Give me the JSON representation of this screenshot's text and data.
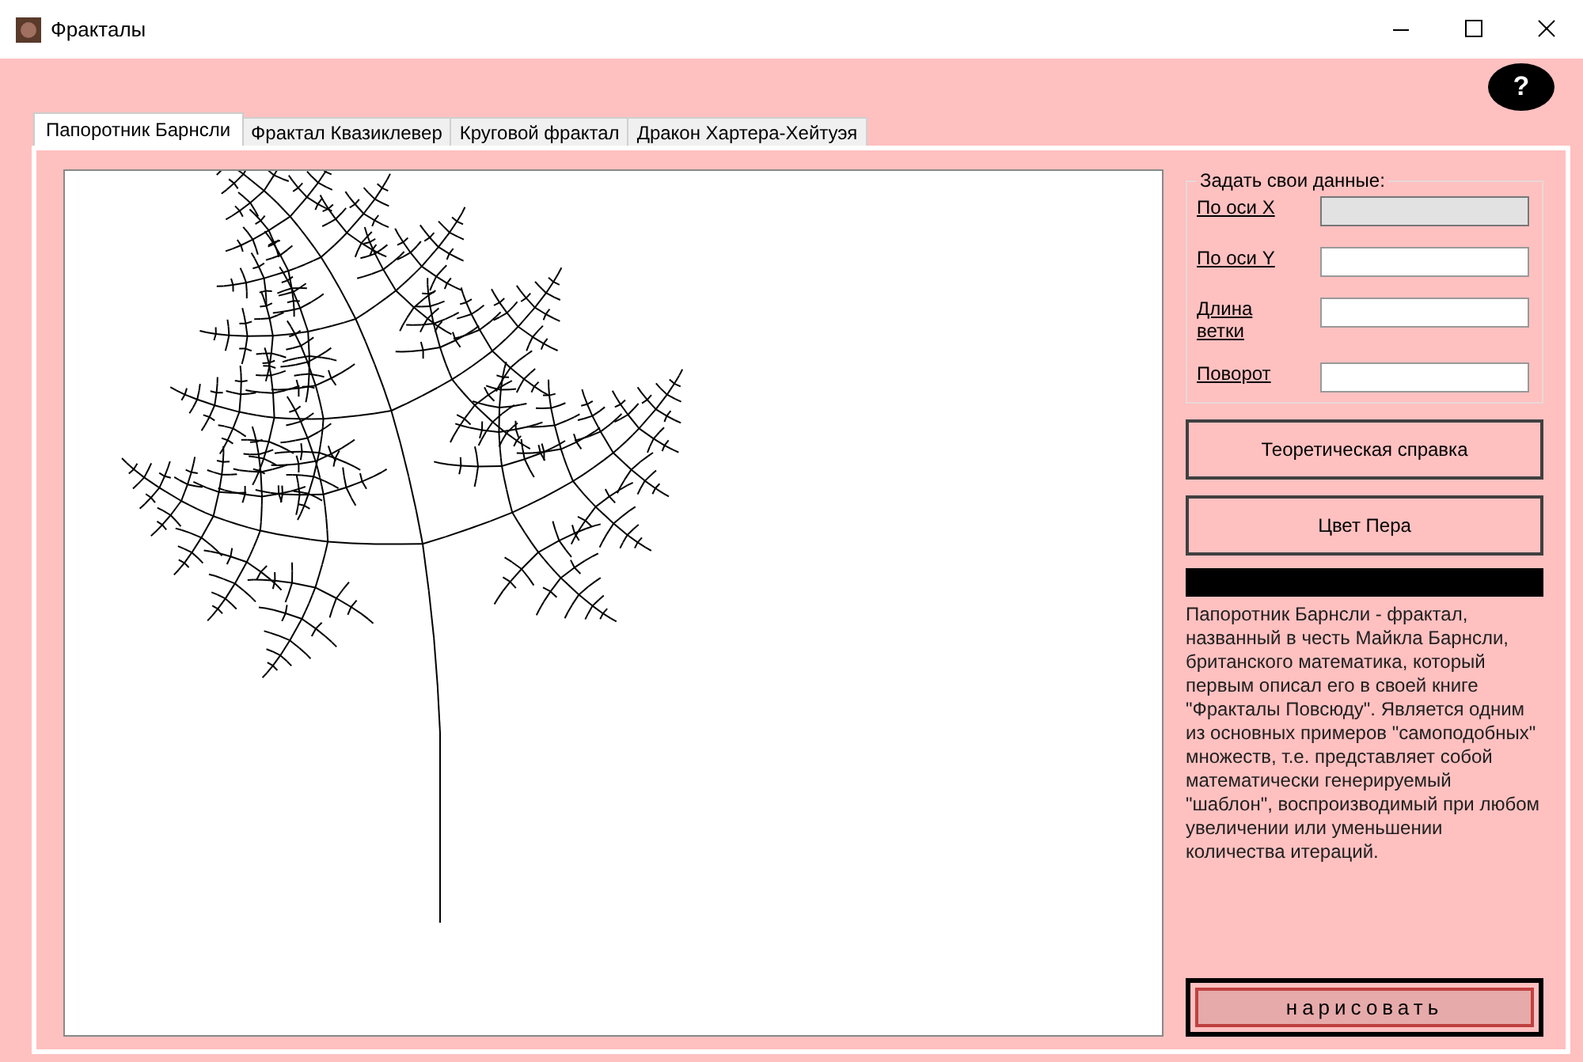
{
  "window": {
    "title": "Фракталы"
  },
  "help_button": {
    "label": "?"
  },
  "tabs": [
    {
      "label": "Папоротник Барнсли",
      "selected": true
    },
    {
      "label": "Фрактал Квазиклевер",
      "selected": false
    },
    {
      "label": "Круговой фрактал",
      "selected": false
    },
    {
      "label": "Дракон Хартера-Хейтуэя",
      "selected": false
    }
  ],
  "settings": {
    "title": "Задать свои данные:",
    "fields": [
      {
        "label": "По оси X",
        "disabled": true
      },
      {
        "label": "По оси Y",
        "disabled": false
      },
      {
        "label": "Длина ветки",
        "disabled": false
      },
      {
        "label": "Поворот",
        "disabled": false
      }
    ]
  },
  "buttons": [
    "Теоретическая справка",
    "Цвет Пера"
  ],
  "description": "Папоротник Барнсли - фрактал, названный в честь Майкла Барнсли, британского математика, который первым описал его в своей книге \"Фракталы Повсюду\". Является одним из основных примеров \"самоподобных\" множеств, т.е. представляет собой математически генерируемый \"шаблон\", воспроизводимый при любом увеличении или уменьшении количества итераций.",
  "draw_button": "нарисовать"
}
